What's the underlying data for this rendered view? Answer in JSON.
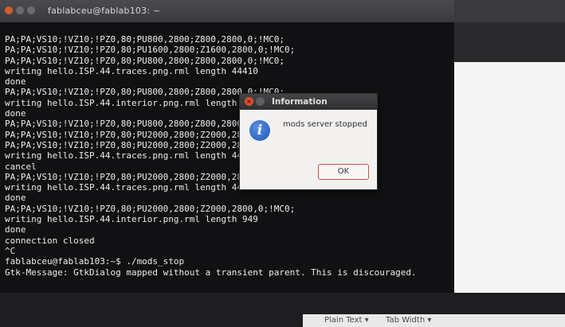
{
  "terminal": {
    "title": "fablabceu@fablab103: ~",
    "lines": [
      "PA;PA;VS10;!VZ10;!PZ0,80;PU800,2800;Z800,2800,0;!MC0;",
      "PA;PA;VS10;!VZ10;!PZ0,80;PU1600,2800;Z1600,2800,0;!MC0;",
      "PA;PA;VS10;!VZ10;!PZ0,80;PU800,2800;Z800,2800,0;!MC0;",
      "writing hello.ISP.44.traces.png.rml length 44410",
      "done",
      "PA;PA;VS10;!VZ10;!PZ0,80;PU800,2800;Z800,2800,0;!MC0;",
      "writing hello.ISP.44.interior.png.rml length 949",
      "done",
      "PA;PA;VS10;!VZ10;!PZ0,80;PU800,2800;Z800,2800,0;!MC0;",
      "PA;PA;VS10;!VZ10;!PZ0,80;PU2000,2800;Z2000,2800,0;!MC0;",
      "PA;PA;VS10;!VZ10;!PZ0,80;PU2000,2800;Z2000,2800,0;!MC0;",
      "writing hello.ISP.44.traces.png.rml length 44819",
      "cancel",
      "PA;PA;VS10;!VZ10;!PZ0,80;PU2000,2800;Z2000,2800,0;!MC0;",
      "writing hello.ISP.44.traces.png.rml length 44819",
      "done",
      "PA;PA;VS10;!VZ10;!PZ0,80;PU2000,2800;Z2000,2800,0;!MC0;",
      "writing hello.ISP.44.interior.png.rml length 949",
      "done",
      "connection closed",
      "^C",
      "fablabceu@fablab103:~$ ./mods_stop",
      "Gtk-Message: GtkDialog mapped without a transient parent. This is discouraged."
    ]
  },
  "dialog": {
    "title": "Information",
    "message": "mods server stopped",
    "ok_label": "OK",
    "icon": "info-icon"
  },
  "statusbar": {
    "mode": "Plain Text ▾",
    "tab_width": "Tab Width ▾"
  },
  "colors": {
    "terminal_bg": "#111113",
    "terminal_fg": "#ececec",
    "close_button": "#df4c2a",
    "info_icon": "#1f57b8"
  }
}
